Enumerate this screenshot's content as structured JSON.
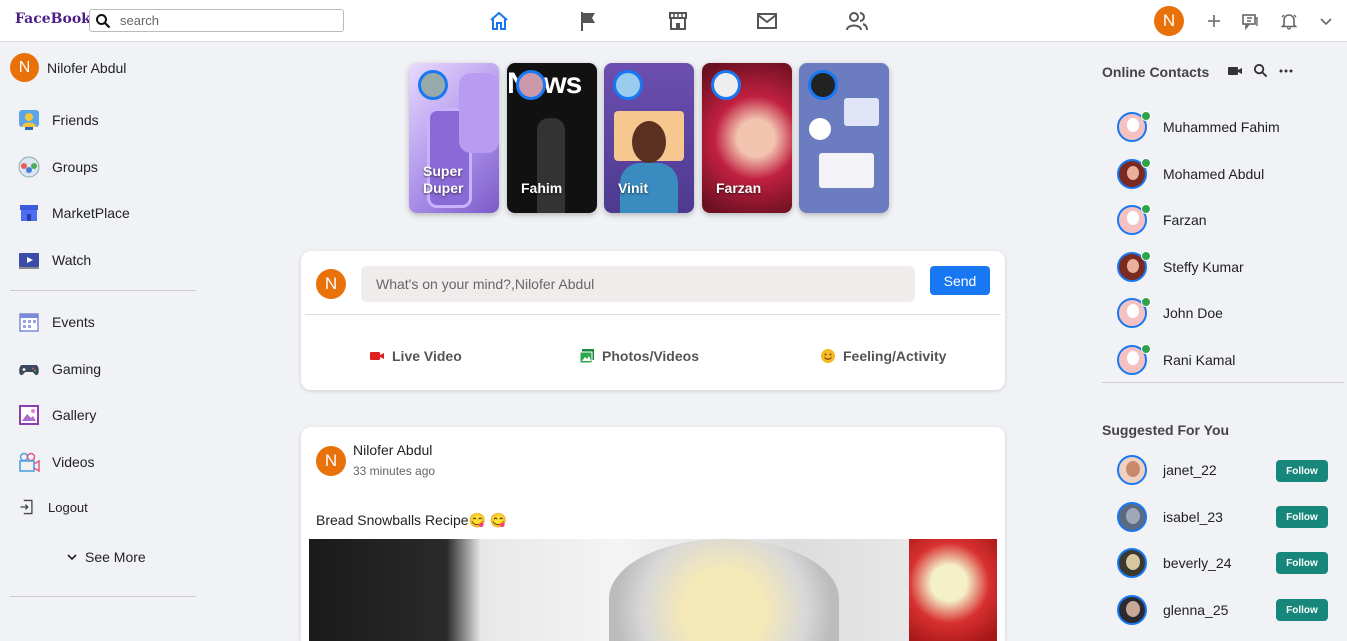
{
  "header": {
    "brand": "FaceBook",
    "search_placeholder": "search",
    "profile_initial": "N"
  },
  "sidebar": {
    "user_name": "Nilofer Abdul",
    "user_initial": "N",
    "items": [
      {
        "label": "Friends",
        "icon": "friends-icon"
      },
      {
        "label": "Groups",
        "icon": "groups-icon"
      },
      {
        "label": "MarketPlace",
        "icon": "marketplace-icon"
      },
      {
        "label": "Watch",
        "icon": "watch-icon"
      },
      {
        "label": "Events",
        "icon": "events-icon"
      },
      {
        "label": "Gaming",
        "icon": "gaming-icon"
      },
      {
        "label": "Gallery",
        "icon": "gallery-icon"
      },
      {
        "label": "Videos",
        "icon": "videos-icon"
      },
      {
        "label": "Logout",
        "icon": "logout-icon"
      }
    ],
    "see_more": "See More"
  },
  "stories": [
    {
      "name": "Super Duper"
    },
    {
      "name": "Fahim"
    },
    {
      "name": "Vinit"
    },
    {
      "name": "Farzan"
    },
    {
      "name": ""
    }
  ],
  "composer": {
    "initial": "N",
    "placeholder": "What's on your mind?,Nilofer Abdul",
    "send_label": "Send",
    "options": [
      "Live Video",
      "Photos/Videos",
      "Feeling/Activity"
    ]
  },
  "post": {
    "initial": "N",
    "author": "Nilofer Abdul",
    "time": "33 minutes ago",
    "text": "Bread Snowballs Recipe😋 😋"
  },
  "contacts": {
    "title": "Online Contacts",
    "list": [
      "Muhammed Fahim",
      "Mohamed Abdul",
      "Farzan",
      "Steffy Kumar",
      "John Doe",
      "Rani Kamal"
    ]
  },
  "suggested": {
    "title": "Suggested For You",
    "follow_label": "Follow",
    "list": [
      "janet_22",
      "isabel_23",
      "beverly_24",
      "glenna_25"
    ]
  },
  "colors": {
    "accent": "#1877f2",
    "avatar": "#e8710a",
    "follow": "#16877a",
    "online": "#31a24c"
  }
}
